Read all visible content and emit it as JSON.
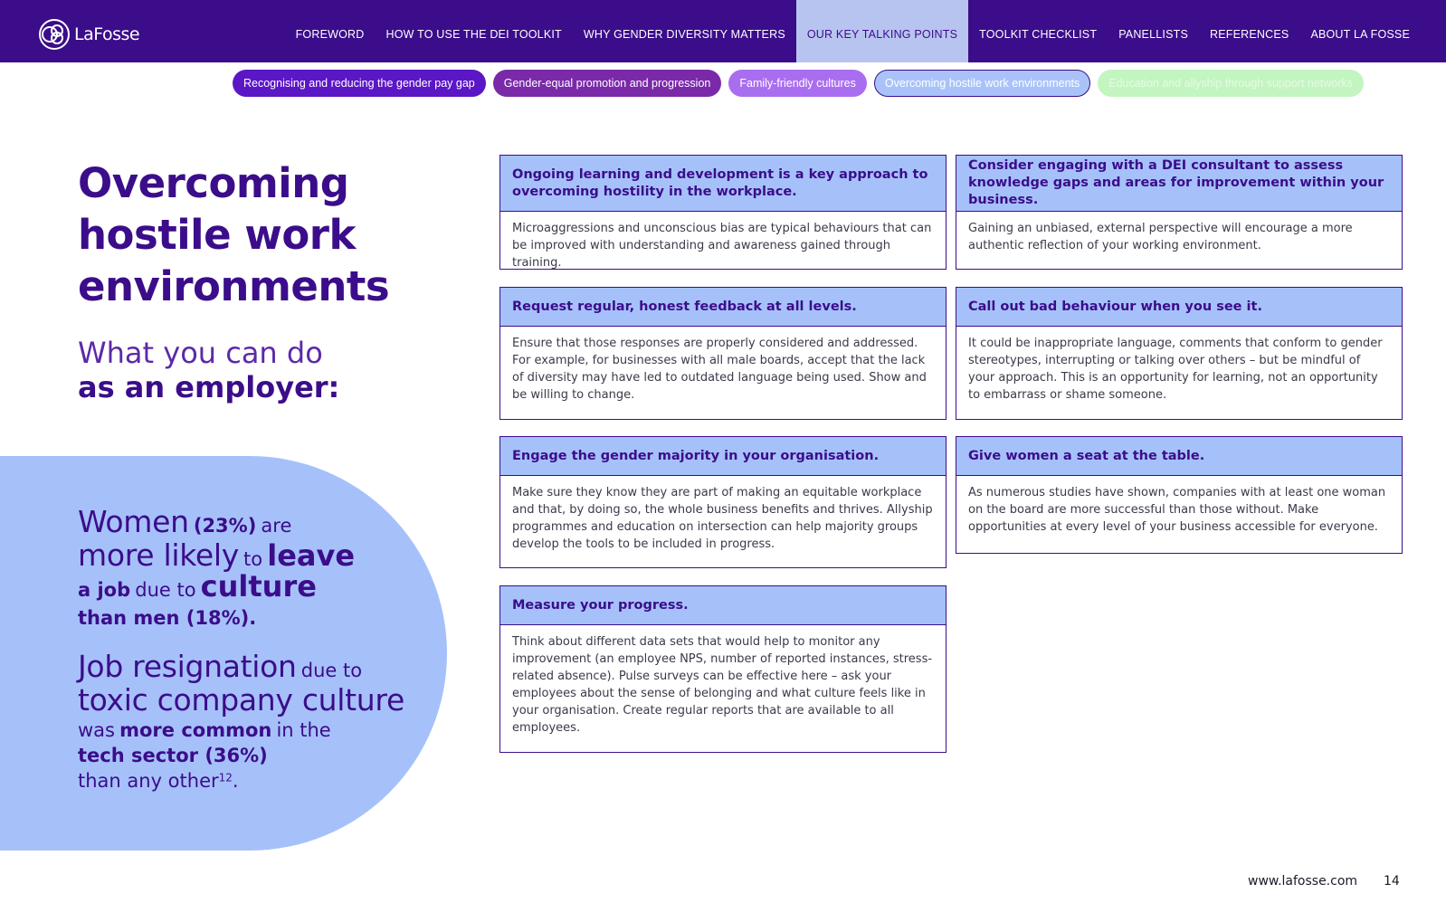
{
  "brand": {
    "name": "LaFosse"
  },
  "nav": {
    "items": [
      {
        "label": "FOREWORD"
      },
      {
        "label": "HOW TO USE THE DEI TOOLKIT"
      },
      {
        "label": "WHY GENDER DIVERSITY MATTERS"
      },
      {
        "label": "OUR KEY TALKING POINTS",
        "active": true
      },
      {
        "label": "TOOLKIT CHECKLIST"
      },
      {
        "label": "PANELLISTS"
      },
      {
        "label": "REFERENCES"
      },
      {
        "label": "ABOUT LA FOSSE"
      }
    ]
  },
  "pills": [
    {
      "label": "Recognising and reducing the gender pay gap",
      "color": "#5b16c6"
    },
    {
      "label": "Gender-equal promotion and progression",
      "color": "#7a2aa8"
    },
    {
      "label": "Family-friendly cultures",
      "color": "#a96ef0"
    },
    {
      "label": "Overcoming hostile work environments",
      "color": "#a9c3fa",
      "active": true
    },
    {
      "label": "Education and allyship through support networks",
      "color": "#c3f5c1"
    }
  ],
  "page": {
    "title_lines": [
      "Overcoming",
      "hostile work",
      "environments"
    ],
    "subtitle_light": "What you can do",
    "subtitle_bold": "as an employer:"
  },
  "stats": {
    "stat1": {
      "w1": "Women",
      "pct": "(23%)",
      "w2": "are",
      "w3": "more likely",
      "w4": "to",
      "w5": "leave",
      "w6": "a job",
      "w7": "due to",
      "w8": "culture",
      "w9": "than men (18%)."
    },
    "stat2": {
      "w1": "Job resignation",
      "w2": "due to",
      "w3": "toxic company culture",
      "w4": "was",
      "w5": "more common",
      "w6": "in the",
      "w7": "tech sector (36%)",
      "w8": "than any other",
      "sup": "12",
      "end": "."
    }
  },
  "cards": [
    {
      "heading": "Ongoing learning and development is a key approach to overcoming hostility in the workplace.",
      "body": "Microaggressions and unconscious bias are typical behaviours that can be improved with understanding and awareness gained through training."
    },
    {
      "heading": "Consider engaging with a DEI consultant to assess knowledge gaps and areas for improvement within your business.",
      "body": "Gaining an unbiased, external perspective will encourage a more authentic reflection of your working environment."
    },
    {
      "heading": "Request regular, honest feedback at all levels.",
      "body": "Ensure that those responses are properly considered and addressed. For example, for businesses with all male boards, accept that the lack of diversity may have led to outdated language being used. Show and be willing to change."
    },
    {
      "heading": "Call out bad behaviour when you see it.",
      "body": "It could be inappropriate language, comments that conform to gender stereotypes, interrupting or talking over others – but be mindful of your approach. This is an opportunity for learning, not an opportunity to embarrass or shame someone."
    },
    {
      "heading": "Engage the gender majority in your organisation.",
      "body": "Make sure they know they are part of making an equitable workplace and that, by doing so, the whole business benefits and thrives. Allyship programmes and education on intersection can help majority groups develop the tools to be included in progress."
    },
    {
      "heading": "Give women a seat at the table.",
      "body": "As numerous studies have shown, companies with at least one woman on the board are more successful than those without. Make opportunities at every level of your business accessible for everyone."
    },
    {
      "heading": "Measure your progress.",
      "body": "Think about different data sets that would help to monitor any improvement (an employee NPS, number of reported instances, stress-related absence). Pulse surveys can be effective here – ask your employees about the sense of belonging and what culture feels like in your organisation. Create regular reports that are available to all employees."
    }
  ],
  "footer": {
    "url": "www.lafosse.com",
    "page_number": "14"
  }
}
